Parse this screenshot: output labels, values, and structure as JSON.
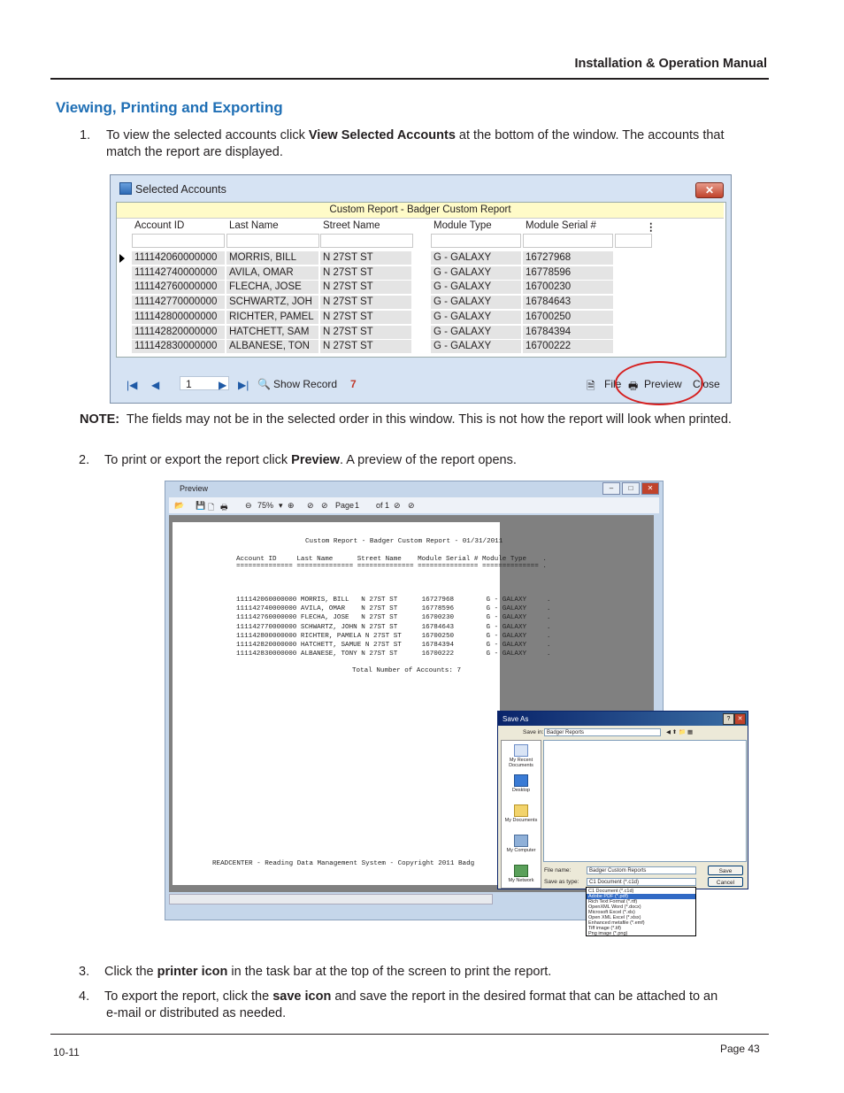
{
  "header": {
    "manual_title": "Installation & Operation Manual"
  },
  "section_title": "Viewing, Printing and Exporting",
  "step1": {
    "num": "1.",
    "pre": "To view the selected accounts click ",
    "bold": "View Selected Accounts",
    "post": " at the bottom of the window. The accounts that",
    "line2": "match the report are displayed."
  },
  "selected_accounts": {
    "title": "Selected Accounts",
    "report_header": "Custom Report - Badger Custom Report",
    "columns": [
      "Account ID",
      "Last Name",
      "Street Name",
      "Module Type",
      "Module Serial #"
    ],
    "rows": [
      [
        "111142060000000",
        "MORRIS, BILL",
        "N 27ST ST",
        "G - GALAXY",
        "16727968"
      ],
      [
        "111142740000000",
        "AVILA, OMAR",
        "N 27ST ST",
        "G - GALAXY",
        "16778596"
      ],
      [
        "111142760000000",
        "FLECHA, JOSE",
        "N 27ST ST",
        "G - GALAXY",
        "16700230"
      ],
      [
        "111142770000000",
        "SCHWARTZ, JOH",
        "N 27ST ST",
        "G - GALAXY",
        "16784643"
      ],
      [
        "111142800000000",
        "RICHTER, PAMEL",
        "N 27ST ST",
        "G - GALAXY",
        "16700250"
      ],
      [
        "111142820000000",
        "HATCHETT, SAM",
        "N 27ST ST",
        "G - GALAXY",
        "16784394"
      ],
      [
        "111142830000000",
        "ALBANESE, TON",
        "N 27ST ST",
        "G - GALAXY",
        "16700222"
      ]
    ],
    "toolbar": {
      "page": "1",
      "show_record": "Show Record",
      "count": "7",
      "file": "File",
      "preview": "Preview",
      "close": "Close"
    }
  },
  "note": {
    "label": "NOTE:",
    "text": "The fields may not be in the selected order in this window. This is not how the report will look when printed."
  },
  "step2": {
    "num": "2.",
    "pre": "To print or export the report click ",
    "bold": "Preview",
    "post": ". A preview of the report opens."
  },
  "preview": {
    "title": "Preview",
    "toolbar": {
      "zoom": "75%",
      "page_label": "Page",
      "page": "1",
      "of": "of 1"
    },
    "report_title": "Custom Report - Badger Custom Report - 01/31/2011",
    "header_line": "Account ID     Last Name      Street Name    Module Serial # Module Type    .",
    "underline": "============== ============== ============== =============== ============== .",
    "rows": [
      "111142060000000 MORRIS, BILL   N 27ST ST      16727968        G - GALAXY     .",
      "111142740000000 AVILA, OMAR    N 27ST ST      16778596        G - GALAXY     .",
      "111142760000000 FLECHA, JOSE   N 27ST ST      16700230        G - GALAXY     .",
      "111142770000000 SCHWARTZ, JOHN N 27ST ST      16784643        G - GALAXY     .",
      "111142800000000 RICHTER, PAMELA N 27ST ST     16700250        G - GALAXY     .",
      "111142820000000 HATCHETT, SAMUE N 27ST ST     16784394        G - GALAXY     .",
      "111142830000000 ALBANESE, TONY N 27ST ST      16700222        G - GALAXY     ."
    ],
    "total": "Total Number of Accounts: 7",
    "footer": "READCENTER - Reading Data Management System - Copyright 2011 Badg"
  },
  "save_as": {
    "title": "Save As",
    "save_in_label": "Save in:",
    "save_in_value": "Badger Reports",
    "places": [
      "My Recent Documents",
      "Desktop",
      "My Documents",
      "My Computer",
      "My Network"
    ],
    "file_name_label": "File name:",
    "file_name_value": "Badger Custom Reports",
    "save_type_label": "Save as type:",
    "save_type_value": "C1 Document (*.c1d)",
    "save_button": "Save",
    "cancel_button": "Cancel",
    "types": [
      "C1 Document (*.c1d)",
      "Adobe PDF (*.pdf)",
      "Rich Text Format (*.rtf)",
      "OpenXML Word (*.docx)",
      "Microsoft Excel (*.xls)",
      "Open XML Excel (*.xlsx)",
      "Enhanced metafile (*.emf)",
      "Tiff image (*.tif)",
      "Png image (*.png)"
    ]
  },
  "step3": {
    "num": "3.",
    "pre": "Click the ",
    "bold": "printer icon",
    "post": " in the task bar at the top of the screen to print the report."
  },
  "step4": {
    "num": "4.",
    "pre": "To export the report, click the ",
    "bold": "save icon",
    "post": " and save the report in the desired format that can be attached to an",
    "line2": "e-mail or distributed as needed."
  },
  "footer": {
    "left": "10-11",
    "right": "Page 43"
  }
}
